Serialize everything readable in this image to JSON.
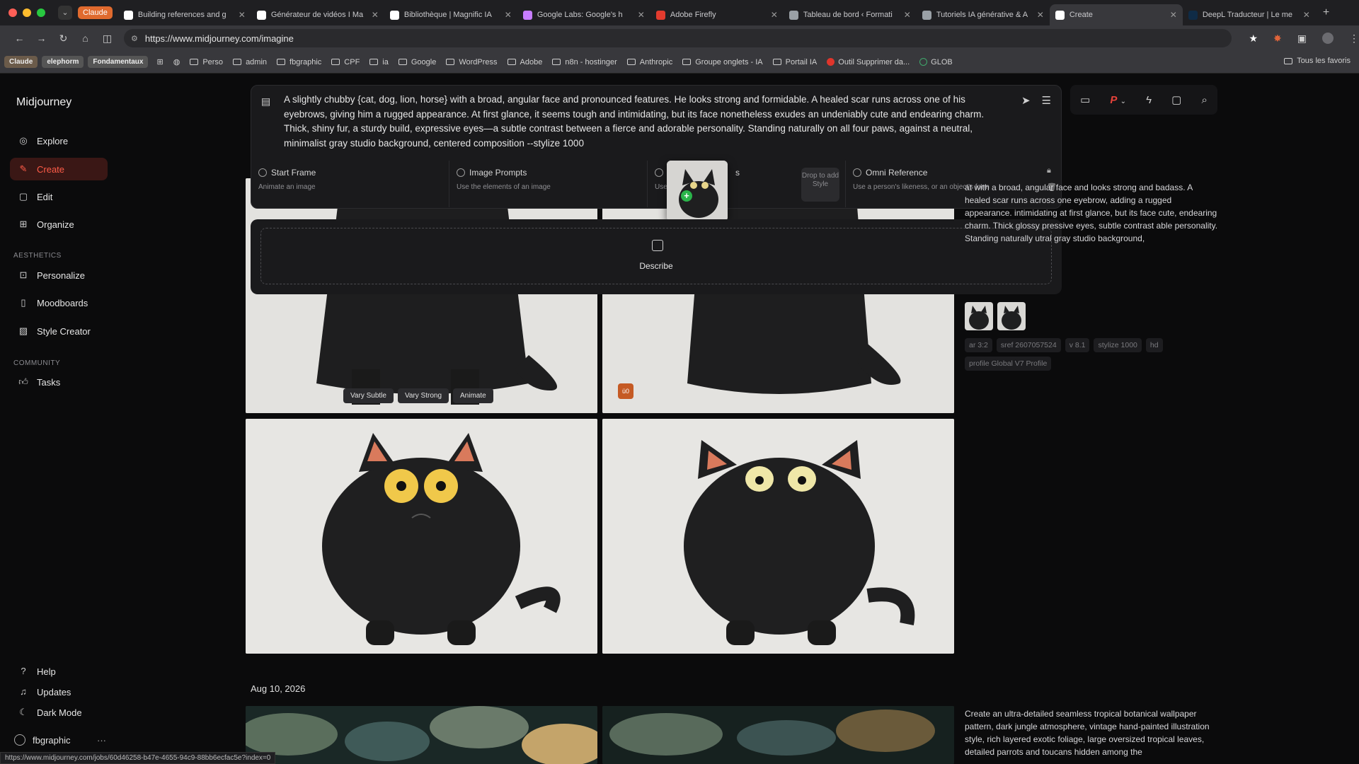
{
  "browser": {
    "claude_chip": "Claude",
    "tabs": [
      {
        "title": "Building references and g",
        "color": "#ffffff"
      },
      {
        "title": "Générateur de vidéos I Ma",
        "color": "#ffffff"
      },
      {
        "title": "Bibliothèque | Magnific IA",
        "color": "#ffffff"
      },
      {
        "title": "Google Labs: Google's h",
        "color": "#c77dff"
      },
      {
        "title": "Adobe Firefly",
        "color": "#e23b2e"
      },
      {
        "title": "Tableau de bord ‹ Formati",
        "color": "#9aa0a6"
      },
      {
        "title": "Tutoriels IA générative & A",
        "color": "#9aa0a6"
      },
      {
        "title": "Create",
        "color": "#ffffff",
        "active": true
      },
      {
        "title": "DeepL Traducteur | Le me",
        "color": "#0f2b46"
      }
    ],
    "url": "https://www.midjourney.com/imagine",
    "bookmarks": {
      "chips": [
        "Claude",
        "elephorm",
        "Fondamentaux"
      ],
      "folders": [
        "Perso",
        "admin",
        "fbgraphic",
        "CPF",
        "ia",
        "Google",
        "WordPress",
        "Adobe",
        "n8n - hostinger",
        "Anthropic",
        "Groupe onglets - IA",
        "Portail IA"
      ],
      "links": [
        "Outil Supprimer da...",
        "GLOB"
      ],
      "right": "Tous les favoris"
    },
    "status_url": "https://www.midjourney.com/jobs/60d46258-b47e-4655-94c9-88bb6ecfac5e?index=0"
  },
  "sidebar": {
    "brand": "Midjourney",
    "items": [
      {
        "label": "Explore",
        "icon": "compass-icon"
      },
      {
        "label": "Create",
        "icon": "brush-icon",
        "active": true
      },
      {
        "label": "Edit",
        "icon": "edit-icon"
      },
      {
        "label": "Organize",
        "icon": "grid-icon"
      }
    ],
    "aesthetics_label": "AESTHETICS",
    "aesthetics": [
      {
        "label": "Personalize",
        "icon": "person-icon"
      },
      {
        "label": "Moodboards",
        "icon": "board-icon"
      },
      {
        "label": "Style Creator",
        "icon": "style-icon"
      }
    ],
    "community_label": "COMMUNITY",
    "community": [
      {
        "label": "Tasks",
        "icon": "thumbs-up-icon"
      }
    ],
    "bottom": [
      {
        "label": "Help",
        "icon": "help-icon"
      },
      {
        "label": "Updates",
        "icon": "bell-icon"
      },
      {
        "label": "Dark Mode",
        "icon": "moon-icon"
      }
    ],
    "user": "fbgraphic"
  },
  "prompt": {
    "text": "A slightly chubby {cat, dog, lion, horse} with a broad, angular face and pronounced features. He looks strong and formidable. A healed scar runs across one of his eyebrows, giving him a rugged appearance. At first glance, it seems tough and intimidating, but its face nonetheless exudes an undeniably cute and endearing charm. Thick, shiny fur, a sturdy build, expressive eyes—a subtle contrast between a fierce and adorable personality. Standing naturally on all four paws, against a neutral, minimalist gray studio background, centered composition --stylize 1000",
    "refs": [
      {
        "title": "Start Frame",
        "sub": "Animate an image"
      },
      {
        "title": "Image Prompts",
        "sub": "Use the elements of an image"
      },
      {
        "title": "s",
        "sub": "Use ... age",
        "drop": "Drop to add Style"
      },
      {
        "title": "Omni Reference",
        "sub": "Use a person's likeness, or an object's form"
      }
    ]
  },
  "describe": {
    "label": "Describe"
  },
  "hover_buttons": [
    "Vary Subtle",
    "Vary Strong",
    "Animate"
  ],
  "orange_badge": "ü0",
  "right_panel": {
    "text": "at with a broad, angular face and  looks strong and badass. A healed scar runs across one eyebrow, adding a rugged appearance.  intimidating at first glance, but its face  cute, endearing charm. Thick glossy  pressive eyes, subtle contrast  able personality. Standing naturally  utral gray studio background,",
    "tags": [
      "ar 3:2",
      "sref 2607057524",
      "v 8.1",
      "stylize 1000",
      "hd",
      "profile Global V7 Profile"
    ]
  },
  "date": "Aug 10, 2026",
  "second_prompt": "Create an ultra-detailed seamless tropical botanical wallpaper pattern, dark jungle atmosphere, vintage hand-painted illustration style, rich layered exotic foliage, large oversized tropical leaves, detailed parrots and toucans hidden among the",
  "profile_chip": "P"
}
